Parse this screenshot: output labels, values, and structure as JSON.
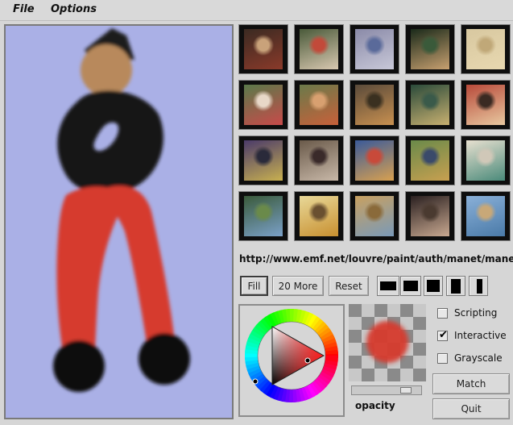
{
  "menu": {
    "file": "File",
    "options": "Options"
  },
  "thumbnails": [
    {
      "name": "thumb-painting-1",
      "palette": [
        "#3a2a22",
        "#8a3a2a",
        "#c9a27a"
      ]
    },
    {
      "name": "thumb-painting-2",
      "palette": [
        "#4a5a3a",
        "#d8c8b0",
        "#c24a3a"
      ]
    },
    {
      "name": "thumb-painting-3",
      "palette": [
        "#8a8aa8",
        "#c8c8d8",
        "#5a6a9a"
      ]
    },
    {
      "name": "thumb-painting-4",
      "palette": [
        "#1a2a1a",
        "#c8a070",
        "#3a5a3a"
      ]
    },
    {
      "name": "thumb-painting-5",
      "palette": [
        "#d8c8a0",
        "#e8d8b0",
        "#c0a878"
      ]
    },
    {
      "name": "thumb-painting-6",
      "palette": [
        "#5a7a4a",
        "#c84a4a",
        "#e8d8c8"
      ]
    },
    {
      "name": "thumb-painting-7",
      "palette": [
        "#6a7a4a",
        "#c8603a",
        "#d8a070"
      ]
    },
    {
      "name": "thumb-painting-8",
      "palette": [
        "#5a4a3a",
        "#c89050",
        "#3a3020"
      ]
    },
    {
      "name": "thumb-painting-9",
      "palette": [
        "#2a4a3a",
        "#c8b070",
        "#3a5a4a"
      ]
    },
    {
      "name": "thumb-painting-10",
      "palette": [
        "#b84a3a",
        "#e8c8a0",
        "#3a2a22"
      ]
    },
    {
      "name": "thumb-painting-11",
      "palette": [
        "#4a3a6a",
        "#c8b050",
        "#2a2a3a"
      ]
    },
    {
      "name": "thumb-painting-12",
      "palette": [
        "#6a5a4a",
        "#c8b8a8",
        "#3a2a2a"
      ]
    },
    {
      "name": "thumb-painting-13",
      "palette": [
        "#3a5a9a",
        "#d8a050",
        "#c84a3a"
      ]
    },
    {
      "name": "thumb-painting-14",
      "palette": [
        "#6a8a4a",
        "#c8a050",
        "#3a4a6a"
      ]
    },
    {
      "name": "thumb-painting-15",
      "palette": [
        "#e8e0d0",
        "#4a8a7a",
        "#d0c8b8"
      ]
    },
    {
      "name": "thumb-painting-16",
      "palette": [
        "#3a5a3a",
        "#7aa0c8",
        "#6a8a4a"
      ]
    },
    {
      "name": "thumb-painting-17",
      "palette": [
        "#e8d898",
        "#c89030",
        "#6a5030"
      ]
    },
    {
      "name": "thumb-painting-18",
      "palette": [
        "#c8a060",
        "#7a9ab8",
        "#8a6a3a"
      ]
    },
    {
      "name": "thumb-painting-19",
      "palette": [
        "#2a2020",
        "#c8a890",
        "#4a3a30"
      ]
    },
    {
      "name": "thumb-painting-20",
      "palette": [
        "#8ab0d8",
        "#4a7aa8",
        "#c8a878"
      ]
    }
  ],
  "url": "http://www.emf.net/louvre/paint/auth/manet/manet.fifre.jpg",
  "buttons": {
    "fill": "Fill",
    "more": "20 More",
    "reset": "Reset",
    "match": "Match",
    "quit": "Quit"
  },
  "options": {
    "scripting": "Scripting",
    "interactive": "Interactive",
    "grayscale": "Grayscale"
  },
  "option_states": {
    "scripting": false,
    "interactive": true,
    "grayscale": false
  },
  "opacity": {
    "label": "opacity",
    "value": 0.85
  },
  "colors": {
    "canvas_bg": "#aab0e6",
    "current_color": "#d63a2e",
    "head": "#b8895c",
    "body": "#141414",
    "legs": "#d63a2e"
  }
}
